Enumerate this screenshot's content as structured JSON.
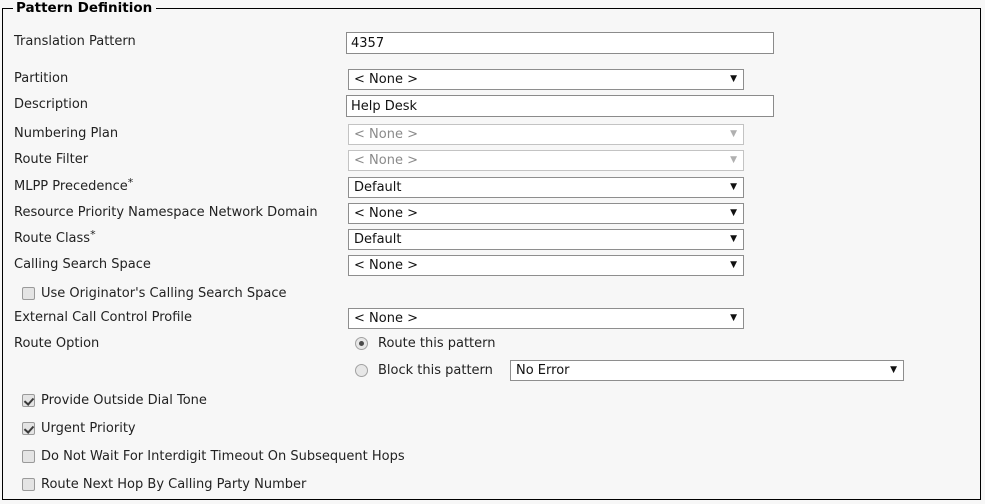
{
  "panel": {
    "legend": "Pattern Definition"
  },
  "fields": [
    {
      "label": "Translation Pattern",
      "type": "text",
      "value": "4357",
      "placeholder": ""
    },
    {
      "label": "Partition",
      "type": "select",
      "value": "< None >",
      "disabled": false
    },
    {
      "label": "Description",
      "type": "text",
      "value": "Help Desk",
      "placeholder": ""
    },
    {
      "label": "Numbering Plan",
      "type": "select",
      "value": "< None >",
      "disabled": true
    },
    {
      "label": "Route Filter",
      "type": "select",
      "value": "< None >",
      "disabled": true
    },
    {
      "label": "MLPP Precedence",
      "required": "*",
      "type": "select",
      "value": "Default",
      "disabled": false
    },
    {
      "label": "Resource Priority Namespace Network Domain",
      "type": "select",
      "value": "< None >",
      "disabled": false
    },
    {
      "label": "Route Class",
      "required": "*",
      "type": "select",
      "value": "Default",
      "disabled": false
    },
    {
      "label": "Calling Search Space",
      "type": "select",
      "value": "< None >",
      "disabled": false
    }
  ],
  "originator_checkbox": {
    "label": "Use Originator's Calling Search Space",
    "checked": false
  },
  "external_profile": {
    "label": "External Call Control Profile",
    "value": "< None >"
  },
  "route_option": {
    "label": "Route Option",
    "route_radio_label": "Route this pattern",
    "route_radio_selected": true,
    "block_radio_label": "Block this pattern",
    "block_radio_selected": false,
    "block_reason_value": "No Error"
  },
  "options": [
    {
      "label": "Provide Outside Dial Tone",
      "checked": true
    },
    {
      "label": "Urgent Priority",
      "checked": true
    },
    {
      "label": "Do Not Wait For Interdigit Timeout On Subsequent Hops",
      "checked": false
    },
    {
      "label": "Route Next Hop By Calling Party Number",
      "checked": false
    }
  ],
  "icons": {
    "dropdown_arrow": "▼"
  },
  "colors": {
    "border": "#000000",
    "background": "#f7f7f7",
    "field_border": "#8b8b8b",
    "disabled_text": "#8a8a8a"
  }
}
